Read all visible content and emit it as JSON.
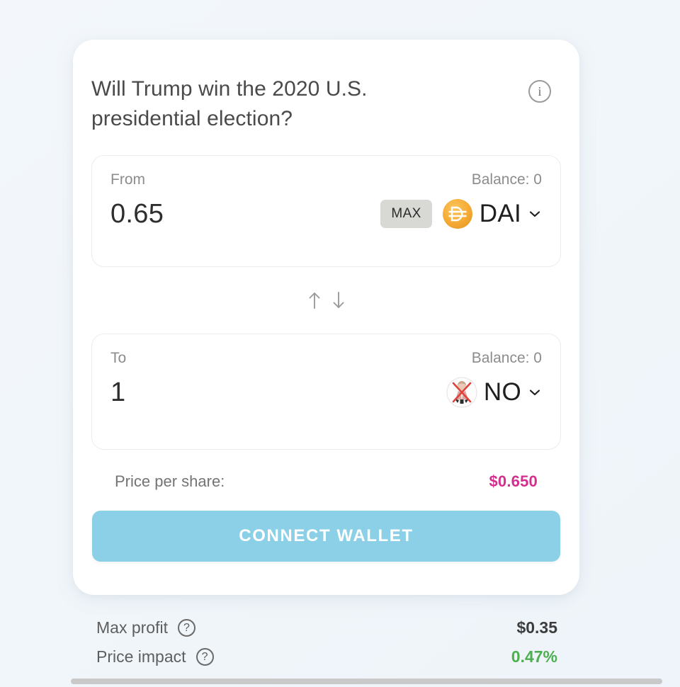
{
  "market": {
    "title": "Will Trump win the 2020 U.S. presidential election?",
    "info_icon": "info-circle-icon",
    "info_glyph": "i"
  },
  "from_section": {
    "label": "From",
    "balance_label": "Balance: 0",
    "amount": "0.65",
    "max_label": "MAX",
    "token_symbol": "DAI",
    "token_icon": "dai-coin-icon",
    "token_color": "#f5ac37",
    "chevron_icon": "chevron-down-icon"
  },
  "swap": {
    "up_arrow_icon": "arrow-up-icon",
    "down_arrow_icon": "arrow-down-icon"
  },
  "to_section": {
    "label": "To",
    "balance_label": "Balance: 0",
    "amount": "1",
    "token_symbol": "NO",
    "token_icon": "no-outcome-avatar-icon",
    "chevron_icon": "chevron-down-icon"
  },
  "price": {
    "label": "Price per share:",
    "value": "$0.650",
    "color": "#d42f8f"
  },
  "action": {
    "connect_label": "CONNECT WALLET",
    "button_color": "#8bd0e7"
  },
  "footer_stats": [
    {
      "label": "Max profit",
      "help_icon": "question-circle-icon",
      "help_glyph": "?",
      "value": "$0.35",
      "value_color": "#3c3c3c"
    },
    {
      "label": "Price impact",
      "help_icon": "question-circle-icon",
      "help_glyph": "?",
      "value": "0.47%",
      "value_color": "#4caf50"
    }
  ]
}
